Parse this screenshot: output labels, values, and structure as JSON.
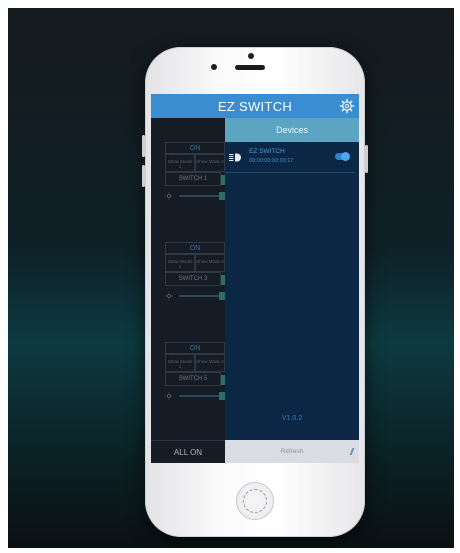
{
  "app": {
    "title": "EZ SWITCH",
    "settings_icon": "gear-icon"
  },
  "main": {
    "cards": [
      {
        "status": "ON",
        "mode1": "Show Model 1",
        "mode2": "Show Mode 2",
        "label": "SWITCH 1"
      },
      {
        "status": "ON",
        "mode1": "Show Model 1",
        "mode2": "Show Mode 2",
        "label": "SWITCH 3"
      },
      {
        "status": "ON",
        "mode1": "Show Model 1",
        "mode2": "Show Mode 2",
        "label": "SWITCH 5"
      }
    ],
    "all_on_label": "ALL ON"
  },
  "drawer": {
    "header": "Devices",
    "devices": [
      {
        "name": "EZ SWITCH",
        "mac": "00:00:00:00:00:17",
        "enabled": true,
        "icon": "headlight-icon"
      }
    ],
    "version": "V1.0.2",
    "refresh_label": "Refresh"
  },
  "colors": {
    "app_bar": "#3a8dd0",
    "drawer_header": "#5ba5c3",
    "drawer_background": "#0c2746",
    "accent": "#4f9fd2"
  }
}
